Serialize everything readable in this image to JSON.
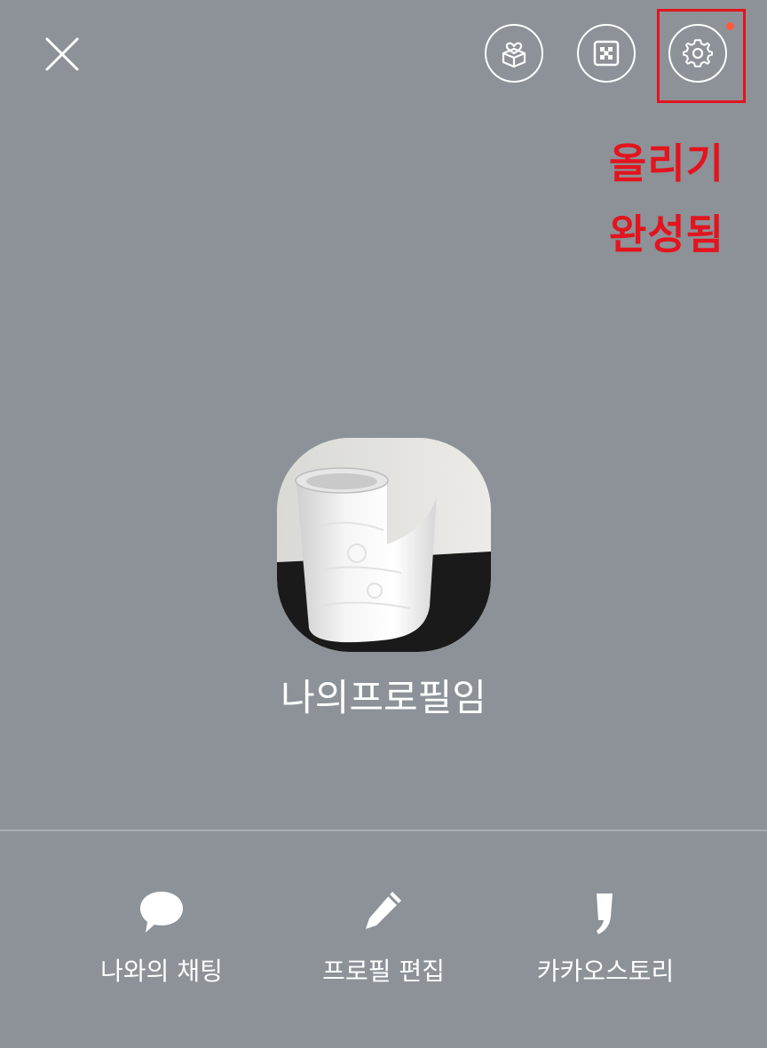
{
  "header": {
    "close_icon": "close-icon",
    "gift_icon": "gift-box-icon",
    "qr_icon": "qr-code-icon",
    "settings_icon": "gear-icon",
    "notification_color": "#ff5a3d"
  },
  "annotation": {
    "line1": "올리기",
    "line2": "완성됨",
    "color": "#e3141e"
  },
  "profile": {
    "name": "나의프로필임"
  },
  "actions": [
    {
      "label": "나와의 채팅",
      "icon": "speech-bubble-icon"
    },
    {
      "label": "프로필 편집",
      "icon": "pencil-icon"
    },
    {
      "label": "카카오스토리",
      "icon": "comma-icon"
    }
  ],
  "colors": {
    "background": "#8c9298",
    "text": "#ffffff"
  }
}
